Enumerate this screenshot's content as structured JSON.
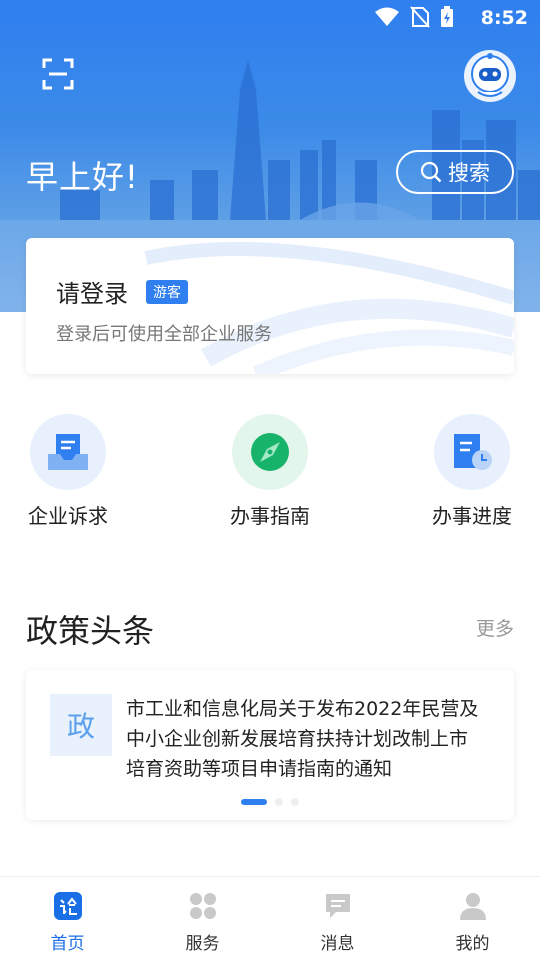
{
  "status_bar": {
    "time": "8:52"
  },
  "header": {
    "greeting": "早上好!",
    "search_label": "搜索"
  },
  "login_card": {
    "title": "请登录",
    "badge": "游客",
    "subtitle": "登录后可使用全部企业服务"
  },
  "quick_entries": [
    {
      "label": "企业诉求",
      "icon": "complaint-inbox-icon"
    },
    {
      "label": "办事指南",
      "icon": "compass-icon"
    },
    {
      "label": "办事进度",
      "icon": "progress-document-icon"
    }
  ],
  "policy_section": {
    "title": "政策头条",
    "more": "更多",
    "news": {
      "thumb_text": "政",
      "headline": "市工业和信息化局关于发布2022年民营及 中小企业创新发展培育扶持计划改制上市 培育资助等项目申请指南的通知"
    },
    "carousel": {
      "total": 3,
      "active": 1
    }
  },
  "tabbar": {
    "items": [
      {
        "label": "首页",
        "icon": "home-icon",
        "active": true
      },
      {
        "label": "服务",
        "icon": "services-grid-icon",
        "active": false
      },
      {
        "label": "消息",
        "icon": "message-icon",
        "active": false
      },
      {
        "label": "我的",
        "icon": "profile-icon",
        "active": false
      }
    ]
  },
  "colors": {
    "primary": "#2f7ff0",
    "hero_blue": "#3b8ae8",
    "text": "#222222",
    "muted": "#999999",
    "active_tab": "#1a6fe6"
  }
}
